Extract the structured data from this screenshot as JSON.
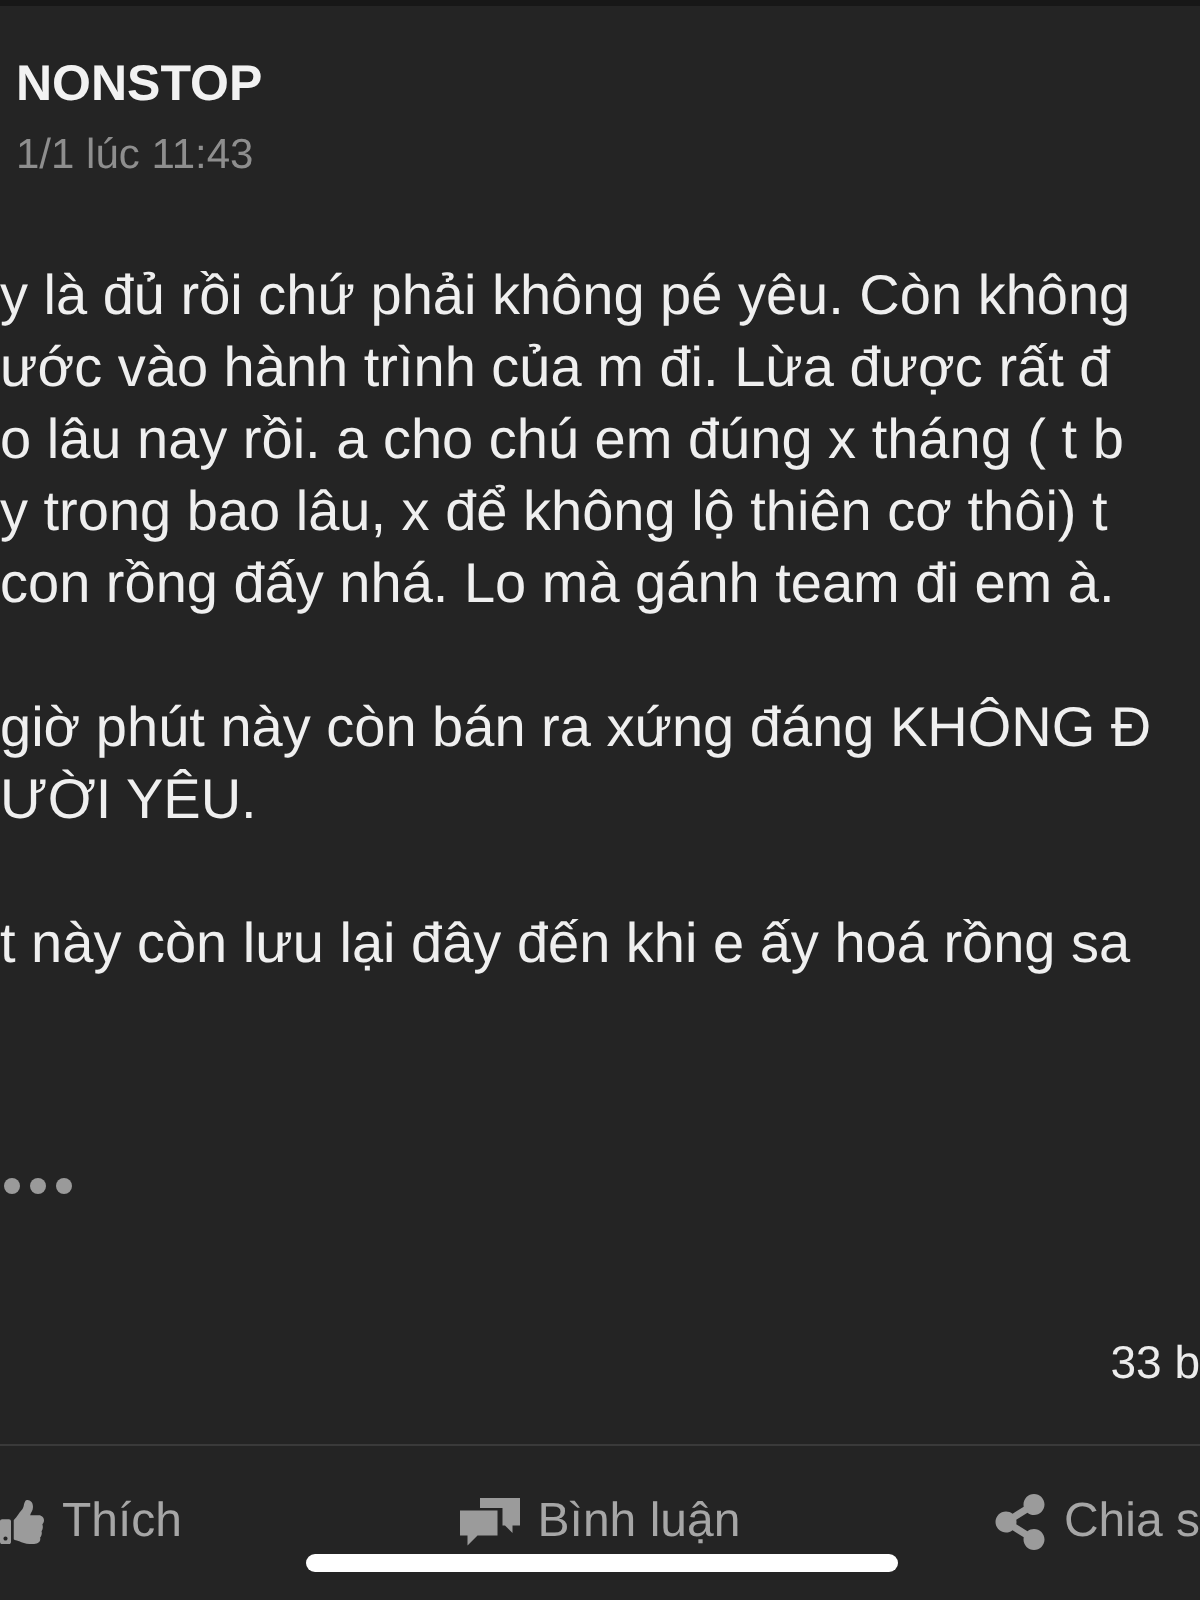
{
  "header": {
    "author": "NONSTOP",
    "time": "1/1 lúc 11:43"
  },
  "post": {
    "paragraphs": [
      {
        "lines": [
          "y là đủ rồi chứ phải không pé yêu. Còn không",
          "ước vào hành trình của m đi. Lừa được rất đ",
          "o lâu nay rồi. a cho chú em đúng x tháng ( t b",
          "y trong bao lâu, x để không lộ thiên cơ thôi) t",
          "con rồng đấy nhá. Lo mà gánh team đi em à."
        ]
      },
      {
        "lines": [
          "giờ phút này còn bán ra xứng đáng KHÔNG Đ",
          "ƯỜI YÊU."
        ]
      },
      {
        "lines": [
          "t này còn lưu lại đây đến khi e ấy hoá rồng sa"
        ]
      }
    ]
  },
  "comment_count": "33 b",
  "actions": [
    {
      "kind": "like",
      "label": "Thích"
    },
    {
      "kind": "comment",
      "label": "Bình luận"
    },
    {
      "kind": "share",
      "label": "Chia s"
    }
  ]
}
